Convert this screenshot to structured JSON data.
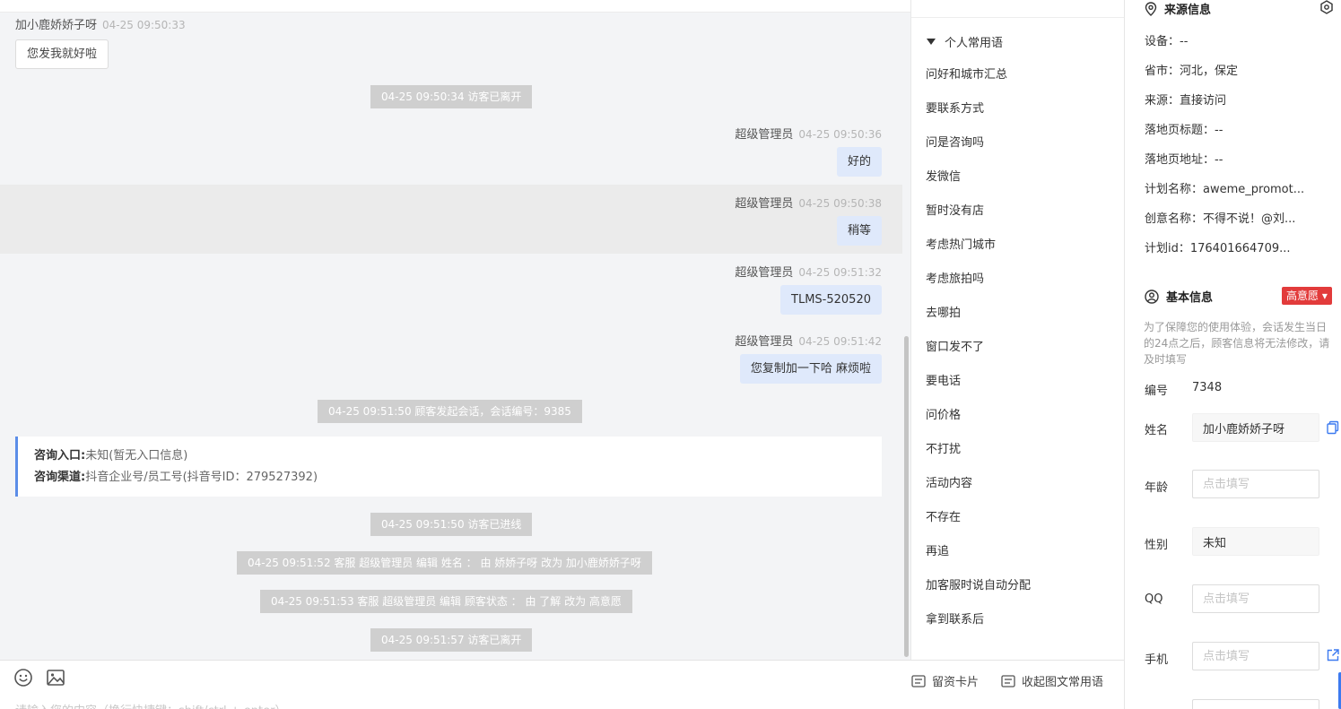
{
  "chat": {
    "messages": [
      {
        "sender": "加小鹿娇娇子呀",
        "time": "04-25 09:50:33",
        "text": "您发我就好啦"
      },
      {
        "system": "04-25 09:50:34 访客已离开"
      },
      {
        "sender": "超级管理员",
        "time": "04-25 09:50:36",
        "text": "好的"
      },
      {
        "sender": "超级管理员",
        "time": "04-25 09:50:38",
        "text": "稍等"
      },
      {
        "sender": "超级管理员",
        "time": "04-25 09:51:32",
        "text": "TLMS-520520"
      },
      {
        "sender": "超级管理员",
        "time": "04-25 09:51:42",
        "text": "您复制加一下哈 麻烦啦"
      },
      {
        "system": "04-25 09:51:50 顾客发起会话，会话编号：9385"
      },
      {
        "system": "04-25 09:51:50 访客已进线"
      },
      {
        "system": "04-25 09:51:52 客服 超级管理员 编辑 姓名 ： 由 娇娇子呀 改为 加小鹿娇娇子呀"
      },
      {
        "system": "04-25 09:51:53 客服 超级管理员 编辑 顾客状态 ： 由 了解 改为 高意愿"
      },
      {
        "system": "04-25 09:51:57 访客已离开"
      }
    ],
    "info_card": {
      "entry_label": "咨询入口:",
      "entry_value": "未知(暂无入口信息)",
      "channel_label": "咨询渠道:",
      "channel_value": "抖音企业号/员工号(抖音号ID：279527392)"
    }
  },
  "composer": {
    "placeholder": "请输入您的内容（换行快捷键：shift/ctrl + enter）",
    "emoji_icon": "smile-icon",
    "image_icon": "image-icon",
    "lead_card_label": "留资卡片",
    "collapse_phrases_label": "收起图文常用语"
  },
  "phrases": {
    "header": "个人常用语",
    "items": [
      "问好和城市汇总",
      "要联系方式",
      "问是咨询吗",
      "发微信",
      "暂时没有店",
      "考虑热门城市",
      "考虑旅拍吗",
      "去哪拍",
      "窗口发不了",
      "要电话",
      "问价格",
      "不打扰",
      "活动内容",
      "不存在",
      "再追",
      "加客服时说自动分配",
      "拿到联系后"
    ]
  },
  "info": {
    "source_title": "来源信息",
    "source_rows": [
      "设备：--",
      "省市：河北，保定",
      "来源：直接访问",
      "落地页标题：--",
      "落地页地址：--",
      "计划名称：aweme_promot...",
      "创意名称：不得不说！@刘...",
      "计划id：176401664709..."
    ],
    "basic_title": "基本信息",
    "intent_badge": "高意愿",
    "note": "为了保障您的使用体验，会话发生当日的24点之后，顾客信息将无法修改，请及时填写",
    "id_label": "编号",
    "id_value": "7348",
    "name_label": "姓名",
    "name_value": "加小鹿娇娇子呀",
    "age_label": "年龄",
    "gender_label": "性别",
    "gender_value": "未知",
    "qq_label": "QQ",
    "phone_label": "手机",
    "fill_placeholder": "点击填写"
  },
  "colors": {
    "accent": "#3c7af0",
    "badge": "#e23b3b",
    "out_bubble": "#dfe9fb",
    "system": "#cfcfcf"
  }
}
